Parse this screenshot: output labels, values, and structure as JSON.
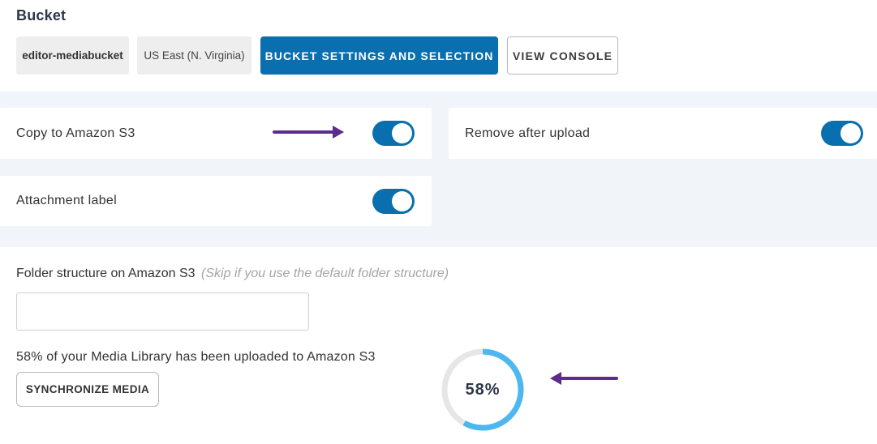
{
  "bucket": {
    "title": "Bucket",
    "name": "editor-mediabucket",
    "region": "US East (N. Virginia)",
    "settings_button": "BUCKET SETTINGS AND SELECTION",
    "console_button": "VIEW CONSOLE"
  },
  "settings": {
    "copy_to_s3": {
      "label": "Copy to Amazon S3",
      "enabled": true
    },
    "remove_after_upload": {
      "label": "Remove after upload",
      "enabled": true
    },
    "attachment_label": {
      "label": "Attachment label",
      "enabled": true
    }
  },
  "folder": {
    "label": "Folder structure on Amazon S3",
    "hint": "(Skip if you use the default folder structure)",
    "value": ""
  },
  "sync": {
    "status_text": "58% of your Media Library has been uploaded to Amazon S3",
    "button": "SYNCHRONIZE MEDIA",
    "percent": 58,
    "percent_label": "58%"
  },
  "colors": {
    "primary": "#0a6fae",
    "ring_progress": "#4db8f0",
    "ring_track": "#e6e6e6",
    "annotation_arrow": "#5b2c8b"
  }
}
